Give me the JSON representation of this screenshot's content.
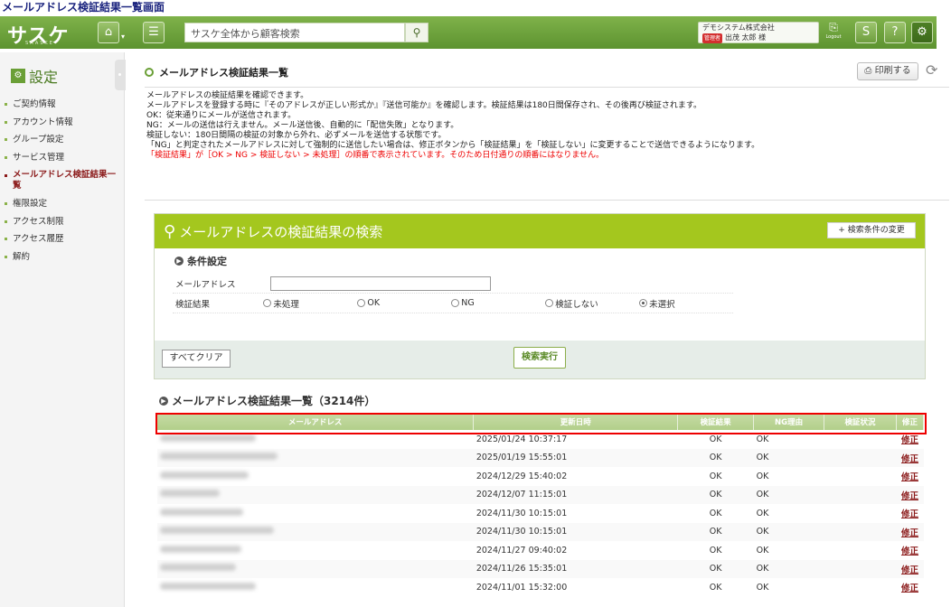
{
  "caption": "メールアドレス検証結果一覧画面",
  "header": {
    "logo": "サスケ",
    "logo_sub": "SAASKE",
    "search_placeholder": "サスケ全体から顧客検索",
    "company": "デモシステム株式会社",
    "admin_badge": "管理者",
    "user": "出茂 太郎 様",
    "logout": "Logout",
    "icons": [
      "home-icon",
      "list-icon",
      "search-icon",
      "logout-icon",
      "s-help-icon",
      "question-icon",
      "gear-icon"
    ]
  },
  "sidebar": {
    "title": "設定",
    "items": [
      "ご契約情報",
      "アカウント情報",
      "グループ設定",
      "サービス管理",
      "メールアドレス検証結果一覧",
      "権限設定",
      "アクセス制限",
      "アクセス履歴",
      "解約"
    ],
    "active_index": 4
  },
  "page": {
    "title": "メールアドレス検証結果一覧",
    "print_label": "印刷する",
    "desc": [
      "メールアドレスの検証結果を確認できます。",
      "メールアドレスを登録する時に『そのアドレスが正しい形式か』『送信可能か』を確認します。検証結果は180日間保存され、その後再び検証されます。",
      "",
      "OK：従来通りにメールが送信されます。",
      "NG：メールの送信は行えません。メール送信後、自動的に「配信失敗」となります。",
      "検証しない：180日間隔の検証の対象から外れ、必ずメールを送信する状態です。",
      "",
      "「NG」と判定されたメールアドレスに対して強制的に送信したい場合は、修正ボタンから「検証結果」を「検証しない」に変更することで送信できるようになります。"
    ],
    "desc_red": "「検証結果」が［OK > NG > 検証しない > 未処理］の順番で表示されています。そのため日付通りの順番にはなりません。"
  },
  "search": {
    "title": "メールアドレスの検証結果の検索",
    "change_condition": "+ 検索条件の変更",
    "condition_title": "条件設定",
    "email_label": "メールアドレス",
    "email_value": "",
    "result_label": "検証結果",
    "radios": [
      "未処理",
      "OK",
      "NG",
      "検証しない",
      "未選択"
    ],
    "selected_radio": "未選択",
    "clear_label": "すべてクリア",
    "exec_label": "検索実行"
  },
  "results": {
    "title": "メールアドレス検証結果一覧（3214件）",
    "columns": [
      "メールアドレス",
      "更新日時",
      "検証結果",
      "NG理由",
      "検証状況",
      "修正"
    ],
    "rows": [
      {
        "date": "2025/01/24 10:37:17",
        "result": "OK",
        "reason": "OK",
        "status": "",
        "fix": "修正",
        "mail_w": 106
      },
      {
        "date": "2025/01/19 15:55:01",
        "result": "OK",
        "reason": "OK",
        "status": "",
        "fix": "修正",
        "mail_w": 130
      },
      {
        "date": "2024/12/29 15:40:02",
        "result": "OK",
        "reason": "OK",
        "status": "",
        "fix": "修正",
        "mail_w": 98
      },
      {
        "date": "2024/12/07 11:15:01",
        "result": "OK",
        "reason": "OK",
        "status": "",
        "fix": "修正",
        "mail_w": 66
      },
      {
        "date": "2024/11/30 10:15:01",
        "result": "OK",
        "reason": "OK",
        "status": "",
        "fix": "修正",
        "mail_w": 92
      },
      {
        "date": "2024/11/30 10:15:01",
        "result": "OK",
        "reason": "OK",
        "status": "",
        "fix": "修正",
        "mail_w": 126
      },
      {
        "date": "2024/11/27 09:40:02",
        "result": "OK",
        "reason": "OK",
        "status": "",
        "fix": "修正",
        "mail_w": 90
      },
      {
        "date": "2024/11/26 15:35:01",
        "result": "OK",
        "reason": "OK",
        "status": "",
        "fix": "修正",
        "mail_w": 84
      },
      {
        "date": "2024/11/01 15:32:00",
        "result": "OK",
        "reason": "OK",
        "status": "",
        "fix": "修正",
        "mail_w": 106
      }
    ]
  }
}
